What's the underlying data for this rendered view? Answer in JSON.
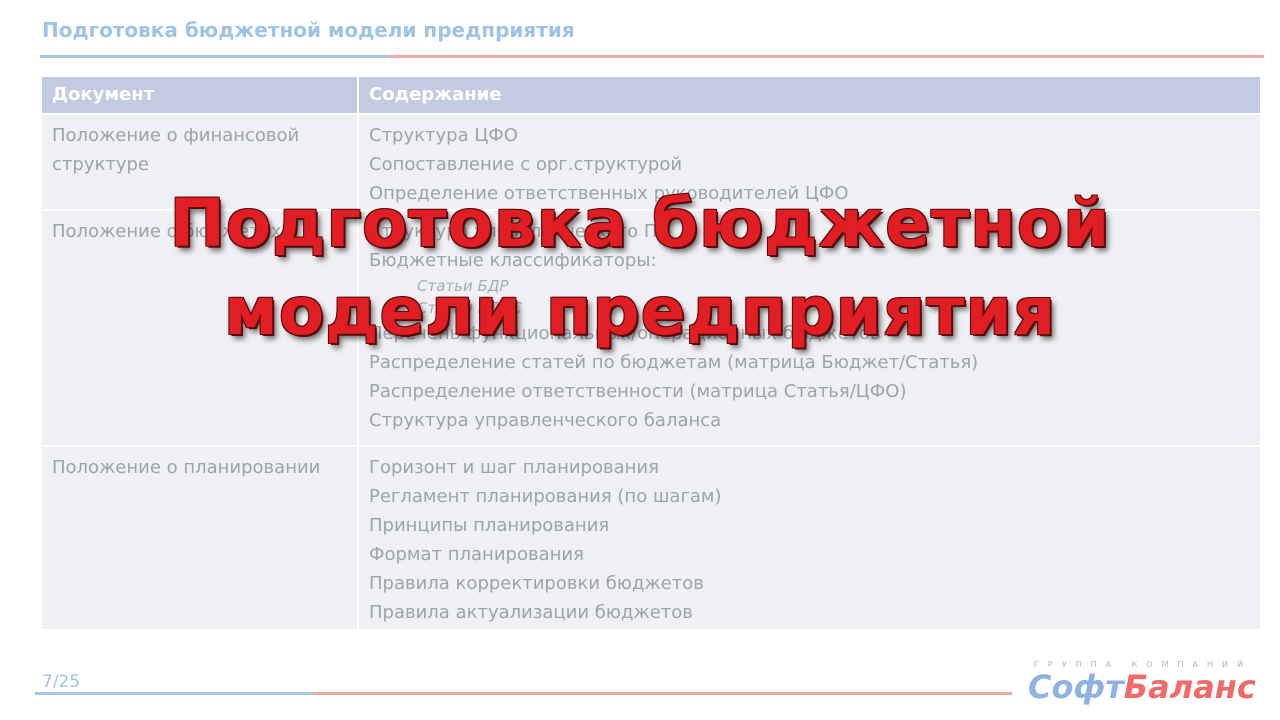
{
  "slide": {
    "title": "Подготовка бюджетной модели предприятия",
    "page": "7/25"
  },
  "table": {
    "headers": [
      "Документ",
      "Содержание"
    ],
    "rows": [
      {
        "document": [
          "Положение о финансовой",
          "структуре"
        ],
        "content": [
          "Структура ЦФО",
          "Сопоставление с орг.структурой",
          "Определение ответственных  руководителей ЦФО"
        ]
      },
      {
        "document": [
          "Положение о бюджетах"
        ],
        "content_before": [
          "Структура управленческого ПП",
          "Бюджетные классификаторы:"
        ],
        "content_sub": [
          "Статьи БДР",
          "Статьи БДДС"
        ],
        "content_after": [
          "Перечень функциональных/операционных бюджетов",
          "Распределение статей по бюджетам (матрица Бюджет/Статья)",
          "Распределение ответственности (матрица Статья/ЦФО)",
          "Структура управленческого баланса"
        ]
      },
      {
        "document": [
          "Положение о планировании"
        ],
        "content": [
          "Горизонт и шаг планирования",
          "Регламент планирования (по шагам)",
          "Принципы планирования",
          "Формат планирования",
          "Правила корректировки бюджетов",
          "Правила актуализации бюджетов"
        ]
      }
    ]
  },
  "overlay": {
    "line1": "Подготовка бюджетной",
    "line2": "модели предприятия"
  },
  "logo": {
    "group": "ГРУППА КОМПАНИЙ",
    "part1": "Софт",
    "part2": "Баланс"
  },
  "colors": {
    "header_bg": "#c3cbe2",
    "row_bg": "#eef0f3",
    "overlay_red": "#e01e24",
    "title_blue": "#9dc3e6"
  }
}
